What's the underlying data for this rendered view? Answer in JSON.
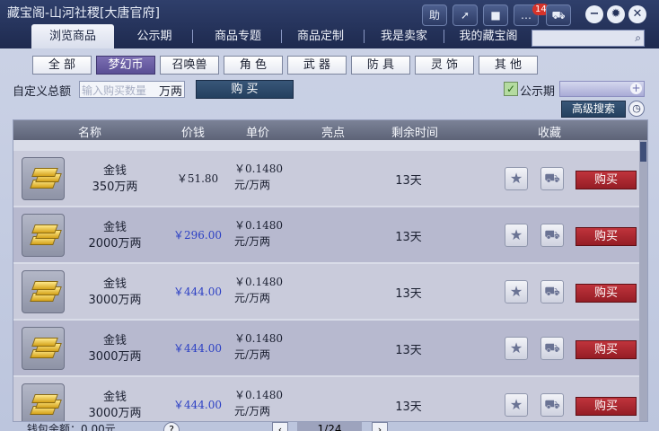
{
  "title": "藏宝阁-山河社稷[大唐官府]",
  "toolbar": {
    "help": "助",
    "notifications_count": "14"
  },
  "tabs": [
    "浏览商品",
    "公示期",
    "商品专题",
    "商品定制",
    "我是卖家",
    "我的藏宝阁"
  ],
  "categories": [
    "全 部",
    "梦幻币",
    "召唤兽",
    "角 色",
    "武 器",
    "防 具",
    "灵 饰",
    "其 他"
  ],
  "custom": {
    "label": "自定义总额",
    "placeholder": "输入购买数量",
    "unit": "万两",
    "buy_button": "购 买"
  },
  "public_period": {
    "label": "公示期",
    "checked": true
  },
  "advanced_search": "高级搜索",
  "columns": [
    "名称",
    "价钱",
    "单价",
    "亮点",
    "剩余时间",
    "收藏"
  ],
  "rows": [
    {
      "name": "金钱",
      "amount": "350万两",
      "price": "￥51.80",
      "unit_price": "￥0.1480",
      "unit": "元/万两",
      "remaining": "13天",
      "buy": "购买"
    },
    {
      "name": "金钱",
      "amount": "2000万两",
      "price": "￥296.00",
      "unit_price": "￥0.1480",
      "unit": "元/万两",
      "remaining": "13天",
      "buy": "购买"
    },
    {
      "name": "金钱",
      "amount": "3000万两",
      "price": "￥444.00",
      "unit_price": "￥0.1480",
      "unit": "元/万两",
      "remaining": "13天",
      "buy": "购买"
    },
    {
      "name": "金钱",
      "amount": "3000万两",
      "price": "￥444.00",
      "unit_price": "￥0.1480",
      "unit": "元/万两",
      "remaining": "13天",
      "buy": "购买"
    },
    {
      "name": "金钱",
      "amount": "3000万两",
      "price": "￥444.00",
      "unit_price": "￥0.1480",
      "unit": "元/万两",
      "remaining": "13天",
      "buy": "购买"
    }
  ],
  "footer": {
    "wallet": "钱包余额：0.00元",
    "help": "?",
    "page": "1/24"
  },
  "colors": {
    "accent_blue": "#2b3fc4",
    "buy_red": "#b0262e",
    "title_bar": "#24325a"
  }
}
